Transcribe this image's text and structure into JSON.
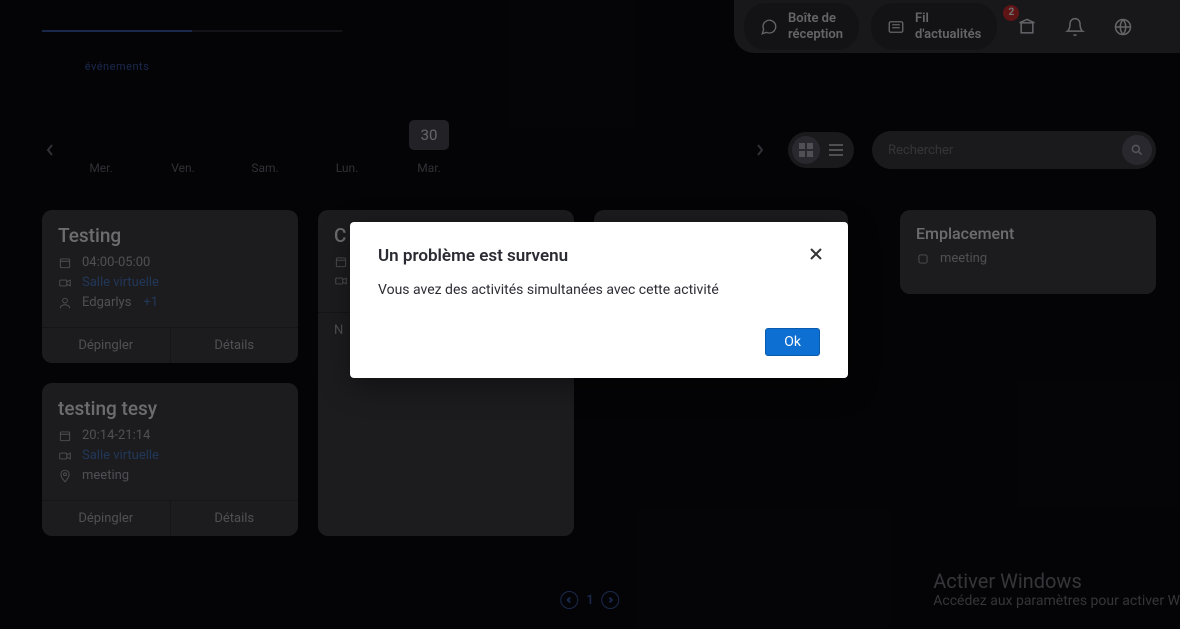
{
  "topnav": {
    "inbox": "Boîte de\nréception",
    "news": "Fil\nd'actualités",
    "badge": "2"
  },
  "tabs": {
    "events": "événements"
  },
  "days": {
    "0": "Mer.",
    "1": "Ven.",
    "2": "Sam.",
    "3": "Lun.",
    "4": "Mar.",
    "active_num": "30"
  },
  "search": {
    "placeholder": "Rechercher"
  },
  "cards": {
    "c1": {
      "title": "Testing",
      "time": "04:00-05:00",
      "room": "Salle virtuelle",
      "attendee": "Edgarlys",
      "plus": "+1",
      "act1": "Dépingler",
      "act2": "Détails"
    },
    "c2": {
      "title": "C",
      "foot": "N"
    },
    "c3": {
      "title": "testing tesy",
      "time": "20:14-21:14",
      "room": "Salle virtuelle",
      "loc": "meeting",
      "act1": "Dépingler",
      "act2": "Détails"
    }
  },
  "panel": {
    "title": "Emplacement",
    "val": "meeting"
  },
  "pagination": {
    "current": "1"
  },
  "watermark": {
    "t": "Activer Windows",
    "s": "Accédez aux paramètres pour activer W"
  },
  "modal": {
    "title": "Un problème est survenu",
    "body": "Vous avez des activités simultanées avec cette activité",
    "ok": "Ok"
  }
}
